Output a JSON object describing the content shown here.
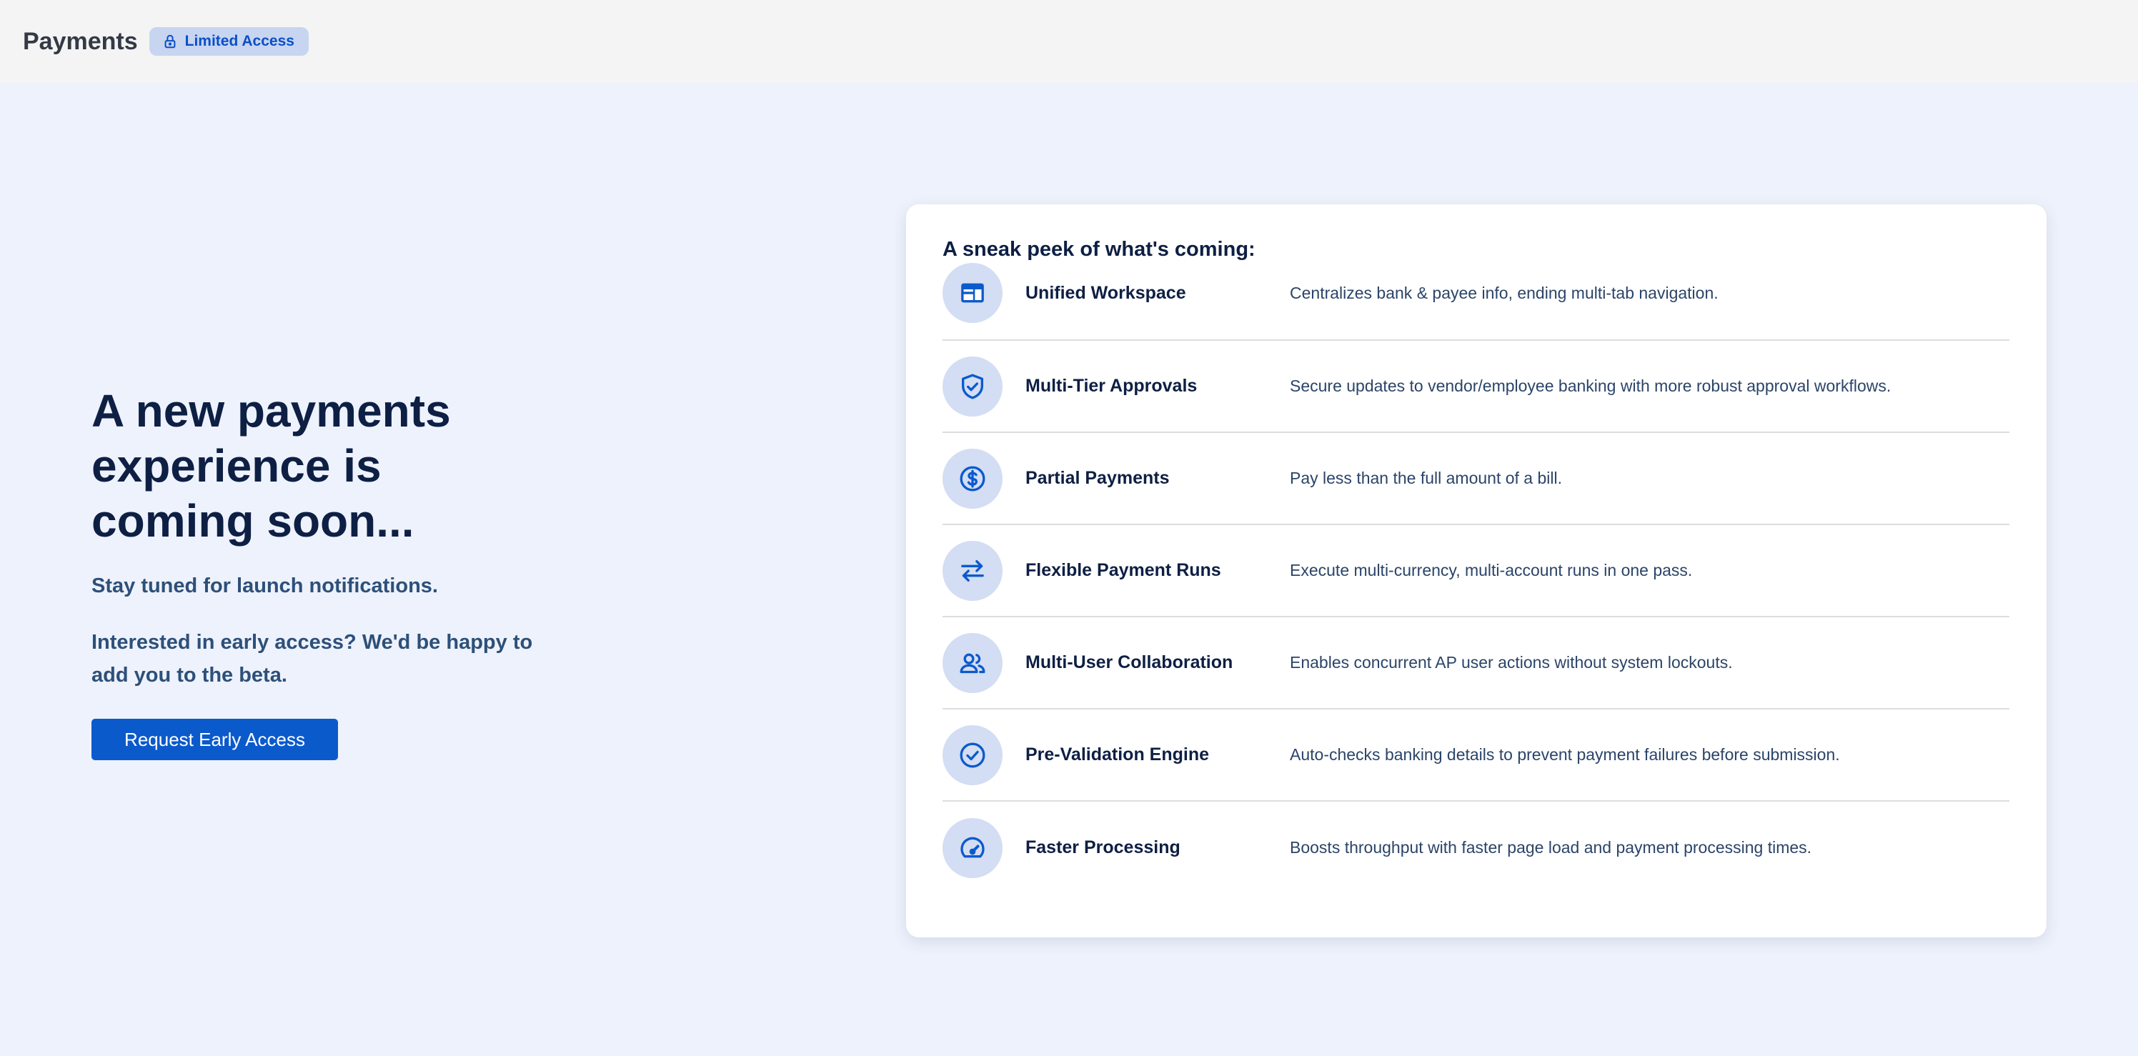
{
  "header": {
    "title": "Payments",
    "badge_label": "Limited Access",
    "badge_icon": "lock-icon"
  },
  "hero": {
    "headline": "A new payments experience is coming soon...",
    "subtitle": "Stay tuned for launch notifications.",
    "early_access_text": "Interested in early access? We'd be happy to add you to the beta.",
    "cta_label": "Request Early Access"
  },
  "features_card": {
    "title": "A sneak peek of what's coming:",
    "items": [
      {
        "icon": "workspace-icon",
        "name": "Unified Workspace",
        "description": "Centralizes bank & payee info, ending multi-tab navigation."
      },
      {
        "icon": "shield-check-icon",
        "name": "Multi-Tier Approvals",
        "description": "Secure updates to vendor/employee banking with more robust approval workflows."
      },
      {
        "icon": "dollar-circle-icon",
        "name": "Partial Payments",
        "description": "Pay less than the full amount of a bill."
      },
      {
        "icon": "swap-arrows-icon",
        "name": "Flexible Payment Runs",
        "description": "Execute multi-currency, multi-account runs in one pass."
      },
      {
        "icon": "users-icon",
        "name": "Multi-User Collaboration",
        "description": "Enables concurrent AP user actions without system lockouts."
      },
      {
        "icon": "check-circle-icon",
        "name": "Pre-Validation Engine",
        "description": "Auto-checks banking details to prevent payment failures before submission."
      },
      {
        "icon": "speedometer-icon",
        "name": "Faster Processing",
        "description": "Boosts throughput with faster page load and payment processing times."
      }
    ]
  },
  "colors": {
    "accent": "#0b5acc",
    "page_background": "#eef2fc",
    "heading": "#0e1f44",
    "icon_circle": "#d3ddf3"
  }
}
